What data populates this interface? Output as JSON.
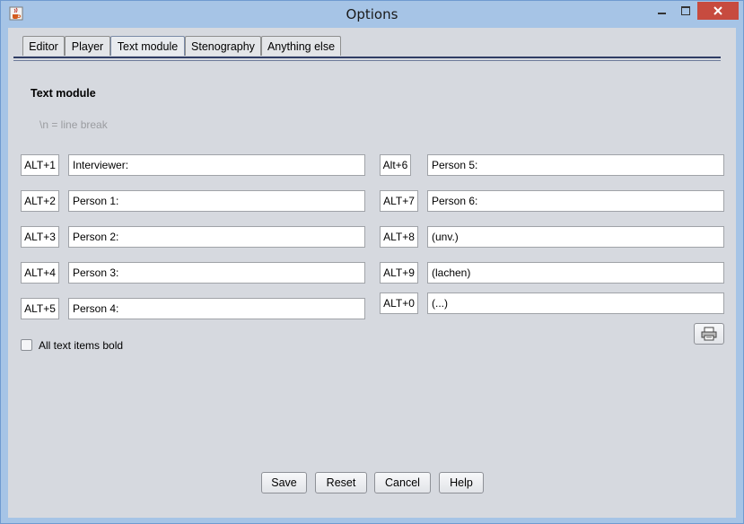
{
  "window": {
    "title": "Options",
    "icons": {
      "app": "java-cup-icon",
      "minimize": "minimize-icon",
      "maximize": "maximize-icon",
      "close": "close-icon"
    }
  },
  "tabs": [
    {
      "label": "Editor"
    },
    {
      "label": "Player"
    },
    {
      "label": "Text module",
      "active": true
    },
    {
      "label": "Stenography"
    },
    {
      "label": "Anything else"
    }
  ],
  "section": {
    "title": "Text module",
    "hint": "\\n = line break"
  },
  "left_items": [
    {
      "key": "ALT+1",
      "value": "Interviewer:"
    },
    {
      "key": "ALT+2",
      "value": "Person 1:"
    },
    {
      "key": "ALT+3",
      "value": "Person 2:"
    },
    {
      "key": "ALT+4",
      "value": "Person 3:"
    },
    {
      "key": "ALT+5",
      "value": "Person 4:"
    }
  ],
  "right_items": [
    {
      "key": "Alt+6",
      "value": "Person 5:"
    },
    {
      "key": "ALT+7",
      "value": "Person 6:"
    },
    {
      "key": "ALT+8",
      "value": "(unv.)"
    },
    {
      "key": "ALT+9",
      "value": "(lachen)"
    },
    {
      "key": "ALT+0",
      "value": "(...)"
    }
  ],
  "bold_option": {
    "label": "All text items bold",
    "checked": false
  },
  "print_button": {
    "icon": "printer-icon"
  },
  "buttons": {
    "save": "Save",
    "reset": "Reset",
    "cancel": "Cancel",
    "help": "Help"
  },
  "colors": {
    "frame": "#a6c4e6",
    "client": "#d6d9df",
    "close": "#c74b3f",
    "tab_line": "#2f3d65"
  }
}
